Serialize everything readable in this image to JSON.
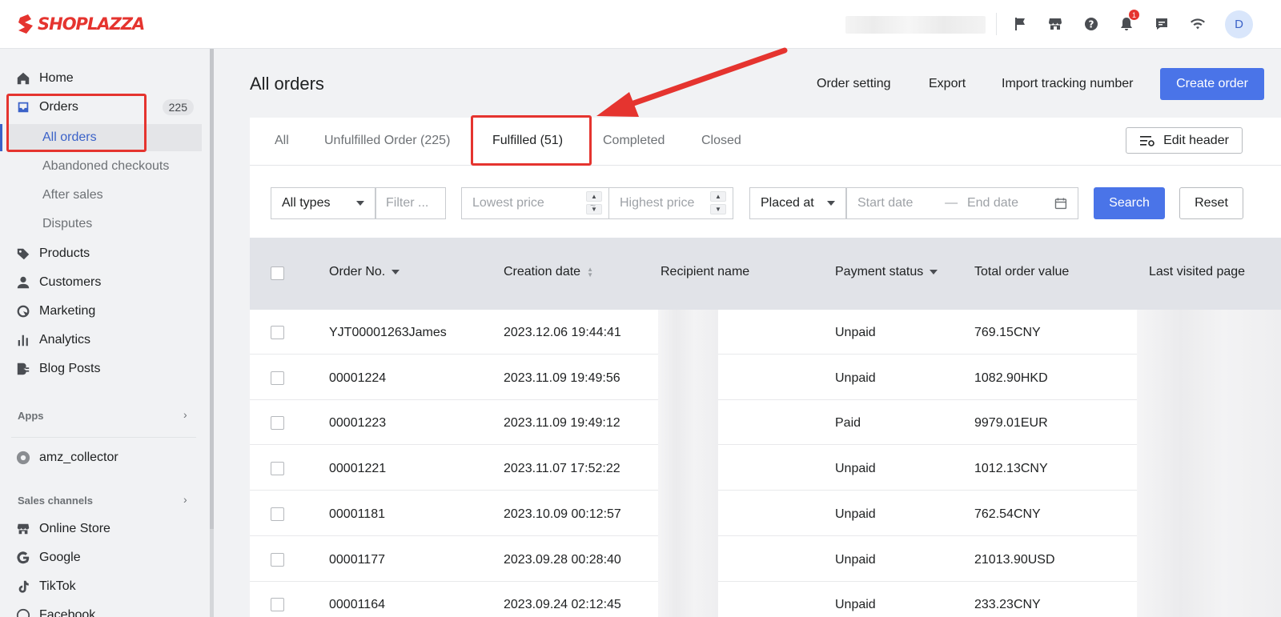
{
  "brand": {
    "name": "SHOPLAZZA"
  },
  "header": {
    "avatar_initial": "D",
    "notification_count": "1",
    "icons": [
      "flag-icon",
      "store-icon",
      "help-icon",
      "bell-icon",
      "chat-icon",
      "wifi-icon"
    ]
  },
  "sidebar": {
    "home": "Home",
    "orders": "Orders",
    "orders_count": "225",
    "all_orders": "All orders",
    "abandoned": "Abandoned checkouts",
    "after_sales": "After sales",
    "disputes": "Disputes",
    "products": "Products",
    "customers": "Customers",
    "marketing": "Marketing",
    "analytics": "Analytics",
    "blog_posts": "Blog Posts",
    "apps_label": "Apps",
    "app_amz": "amz_collector",
    "sales_channels_label": "Sales channels",
    "online_store": "Online Store",
    "google": "Google",
    "tiktok": "TikTok",
    "facebook": "Facebook"
  },
  "page": {
    "title": "All orders",
    "order_setting": "Order setting",
    "export": "Export",
    "import_tracking": "Import tracking number",
    "create_order": "Create order"
  },
  "tabs": {
    "all": "All",
    "unfulfilled": "Unfulfilled Order  (225)",
    "fulfilled": "Fulfilled  (51)",
    "completed": "Completed",
    "closed": "Closed",
    "edit_header": "Edit header"
  },
  "filters": {
    "type": "All types",
    "filter_placeholder": "Filter ...",
    "lowest_price": "Lowest price",
    "range_sep": "~",
    "highest_price": "Highest price",
    "placed_at": "Placed at",
    "start_date": "Start date",
    "date_sep": "—",
    "end_date": "End date",
    "search": "Search",
    "reset": "Reset"
  },
  "table": {
    "columns": {
      "order_no": "Order No.",
      "creation_date": "Creation date",
      "recipient": "Recipient name",
      "payment_status": "Payment status",
      "total": "Total order value",
      "last_visited": "Last visited page"
    },
    "rows": [
      {
        "order_no": "YJT00001263James",
        "date": "2023.12.06 19:44:41",
        "payment": "Unpaid",
        "total": "769.15CNY"
      },
      {
        "order_no": "00001224",
        "date": "2023.11.09 19:49:56",
        "payment": "Unpaid",
        "total": "1082.90HKD"
      },
      {
        "order_no": "00001223",
        "date": "2023.11.09 19:49:12",
        "payment": "Paid",
        "total": "9979.01EUR"
      },
      {
        "order_no": "00001221",
        "date": "2023.11.07 17:52:22",
        "payment": "Unpaid",
        "total": "1012.13CNY"
      },
      {
        "order_no": "00001181",
        "date": "2023.10.09 00:12:57",
        "payment": "Unpaid",
        "total": "762.54CNY"
      },
      {
        "order_no": "00001177",
        "date": "2023.09.28 00:28:40",
        "payment": "Unpaid",
        "total": "21013.90USD"
      },
      {
        "order_no": "00001164",
        "date": "2023.09.24 02:12:45",
        "payment": "Unpaid",
        "total": "233.23CNY"
      }
    ]
  },
  "colors": {
    "accent": "#4a74e8",
    "annotation": "#e5342f"
  }
}
